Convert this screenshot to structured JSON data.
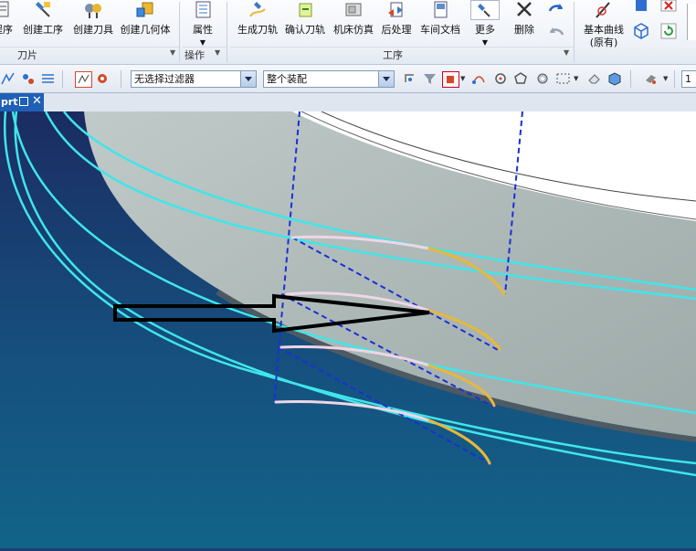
{
  "ribbon": {
    "buttons": [
      {
        "label": "程序",
        "icon": "create-program-icon"
      },
      {
        "label": "创建工序",
        "icon": "create-operation-icon"
      },
      {
        "label": "创建刀具",
        "icon": "create-tool-icon"
      },
      {
        "label": "创建几何体",
        "icon": "create-geometry-icon"
      },
      {
        "label": "属性",
        "icon": "properties-icon"
      },
      {
        "label": "生成刀轨",
        "icon": "generate-toolpath-icon"
      },
      {
        "label": "确认刀轨",
        "icon": "verify-toolpath-icon"
      },
      {
        "label": "机床仿真",
        "icon": "machine-simulation-icon"
      },
      {
        "label": "后处理",
        "icon": "postprocess-icon"
      },
      {
        "label": "车间文档",
        "icon": "shop-documentation-icon"
      },
      {
        "label": "更多",
        "icon": "more-icon"
      },
      {
        "label": "删除",
        "icon": "delete-icon"
      },
      {
        "label": "基本曲线",
        "label2": "(原有)",
        "icon": "basic-curves-icon"
      }
    ],
    "groups": [
      "刀片",
      "操作",
      "工序"
    ]
  },
  "toolbar": {
    "selection_filter": "无选择过滤器",
    "assembly_scope": "整个装配",
    "partial_value": "1"
  },
  "tab": {
    "name": "prt"
  },
  "colors": {
    "ribbon_bg": "#eef2f8",
    "viewport_top": "#1c2e62",
    "viewport_bottom": "#13607f",
    "cyan_curve": "#3fe6ea",
    "dashed_blue": "#1a2fd6",
    "yellow_toolpath": "#e9b83a",
    "part_surface": "#a9b7b5"
  }
}
